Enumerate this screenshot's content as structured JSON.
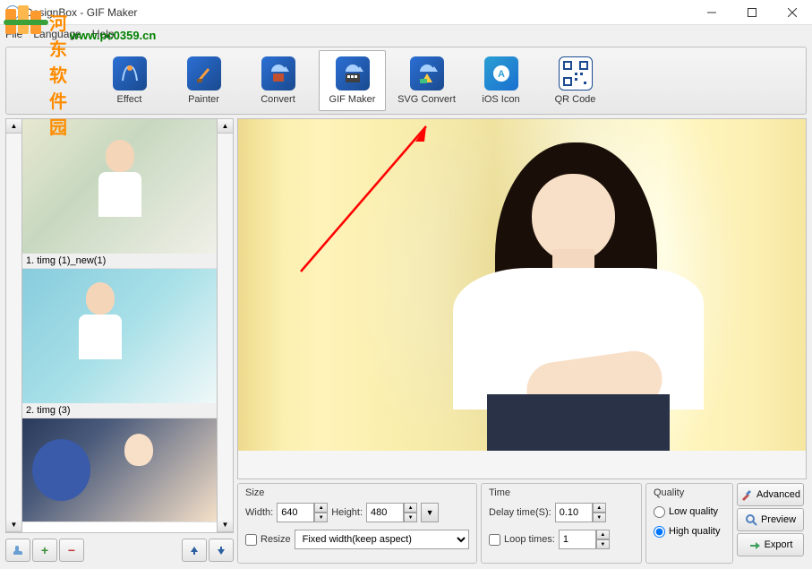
{
  "window": {
    "title": "DesignBox - GIF Maker"
  },
  "watermark": {
    "text1": "河东软件园",
    "text2": "www.pc0359.cn"
  },
  "menu": {
    "file": "File",
    "language": "Language",
    "help": "Help"
  },
  "toolbar": {
    "effect": "Effect",
    "painter": "Painter",
    "convert": "Convert",
    "gifmaker": "GIF Maker",
    "svgconvert": "SVG Convert",
    "iosicon": "iOS Icon",
    "qrcode": "QR Code"
  },
  "thumbs": {
    "item1_label": "1. timg (1)_new(1)",
    "item2_label": "2. timg (3)"
  },
  "size": {
    "legend": "Size",
    "width_label": "Width:",
    "width_value": "640",
    "height_label": "Height:",
    "height_value": "480",
    "resize_label": "Resize",
    "mode_value": "Fixed width(keep aspect)"
  },
  "time": {
    "legend": "Time",
    "delay_label": "Delay time(S):",
    "delay_value": "0.10",
    "loop_label": "Loop times:",
    "loop_value": "1"
  },
  "quality": {
    "legend": "Quality",
    "low": "Low quality",
    "high": "High quality"
  },
  "actions": {
    "advanced": "Advanced",
    "preview": "Preview",
    "export": "Export"
  }
}
